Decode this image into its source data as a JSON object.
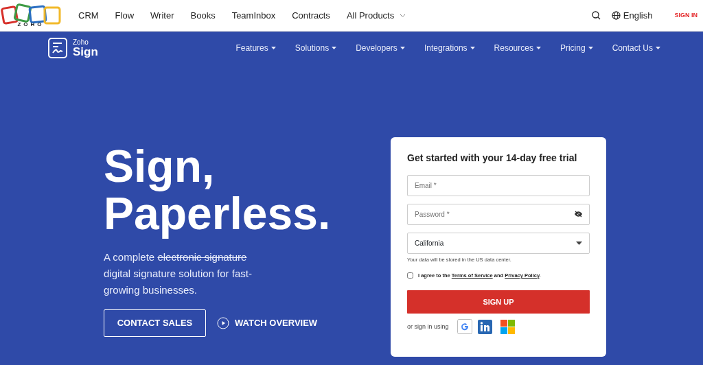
{
  "top_nav": {
    "logo_text": "ZOHO",
    "links": [
      {
        "label": "CRM"
      },
      {
        "label": "Flow"
      },
      {
        "label": "Writer"
      },
      {
        "label": "Books"
      },
      {
        "label": "TeamInbox"
      },
      {
        "label": "Contracts"
      },
      {
        "label": "All Products",
        "dropdown": true
      }
    ],
    "language": "English",
    "sign_in": "SIGN IN"
  },
  "product_nav": {
    "brand_small": "Zoho",
    "brand_large": "Sign",
    "menus": [
      {
        "label": "Features"
      },
      {
        "label": "Solutions"
      },
      {
        "label": "Developers"
      },
      {
        "label": "Integrations"
      },
      {
        "label": "Resources"
      },
      {
        "label": "Pricing"
      },
      {
        "label": "Contact Us"
      }
    ]
  },
  "hero": {
    "title_lines": [
      "Sign,",
      "Paperless."
    ],
    "lead_start": "A complete",
    "lead_struck": "electronic signature",
    "lead_end": "digital signature solution for fast-growing businesses.",
    "primary_button": "CONTACT SALES",
    "video_link": "WATCH OVERVIEW"
  },
  "signup": {
    "heading": "Get started with your 14-day free trial",
    "email": {
      "placeholder": "Email *"
    },
    "password": {
      "placeholder": "Password *"
    },
    "region": {
      "value": "California"
    },
    "region_note": "Your data will be stored in the US data center.",
    "agree": {
      "checked": false,
      "parts": [
        {
          "kind": "text",
          "text": "I agree to the"
        },
        {
          "kind": "link",
          "text": "Terms of Service"
        },
        {
          "kind": "text",
          "text": "and"
        },
        {
          "kind": "link",
          "text": "Privacy Policy"
        },
        {
          "kind": "text",
          "text": "."
        }
      ]
    },
    "submit": "SIGN UP",
    "social_label": "or sign in using"
  }
}
